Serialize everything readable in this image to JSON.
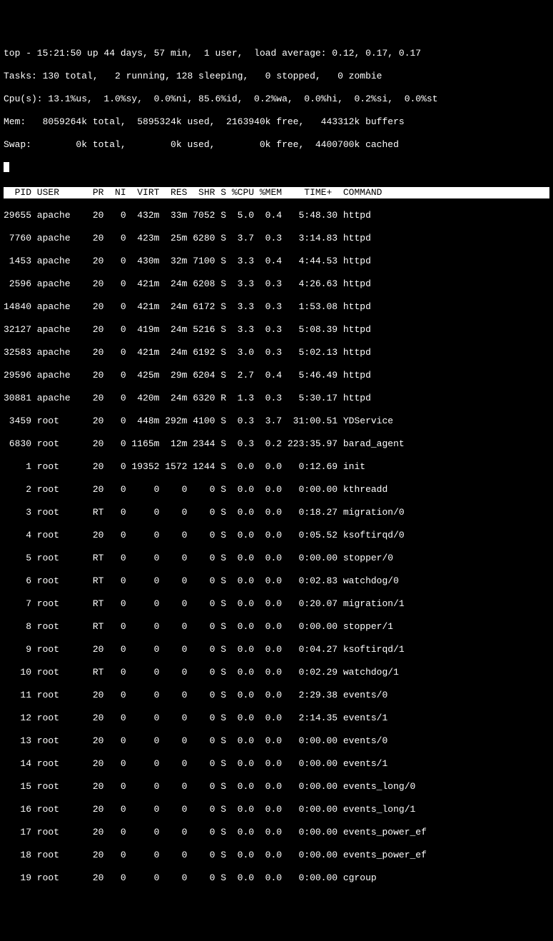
{
  "summary": {
    "line1": "top - 15:21:50 up 44 days, 57 min,  1 user,  load average: 0.12, 0.17, 0.17",
    "line2": "Tasks: 130 total,   2 running, 128 sleeping,   0 stopped,   0 zombie",
    "line3": "Cpu(s): 13.1%us,  1.0%sy,  0.0%ni, 85.6%id,  0.2%wa,  0.0%hi,  0.2%si,  0.0%st",
    "line4": "Mem:   8059264k total,  5895324k used,  2163940k free,   443312k buffers",
    "line5": "Swap:        0k total,        0k used,        0k free,  4400700k cached"
  },
  "header": "  PID USER      PR  NI  VIRT  RES  SHR S %CPU %MEM    TIME+  COMMAND           ",
  "rows": [
    "29655 apache    20   0  432m  33m 7052 S  5.0  0.4   5:48.30 httpd",
    " 7760 apache    20   0  423m  25m 6280 S  3.7  0.3   3:14.83 httpd",
    " 1453 apache    20   0  430m  32m 7100 S  3.3  0.4   4:44.53 httpd",
    " 2596 apache    20   0  421m  24m 6208 S  3.3  0.3   4:26.63 httpd",
    "14840 apache    20   0  421m  24m 6172 S  3.3  0.3   1:53.08 httpd",
    "32127 apache    20   0  419m  24m 5216 S  3.3  0.3   5:08.39 httpd",
    "32583 apache    20   0  421m  24m 6192 S  3.0  0.3   5:02.13 httpd",
    "29596 apache    20   0  425m  29m 6204 S  2.7  0.4   5:46.49 httpd",
    "30881 apache    20   0  420m  24m 6320 R  1.3  0.3   5:30.17 httpd",
    " 3459 root      20   0  448m 292m 4100 S  0.3  3.7  31:00.51 YDService",
    " 6830 root      20   0 1165m  12m 2344 S  0.3  0.2 223:35.97 barad_agent",
    "    1 root      20   0 19352 1572 1244 S  0.0  0.0   0:12.69 init",
    "    2 root      20   0     0    0    0 S  0.0  0.0   0:00.00 kthreadd",
    "    3 root      RT   0     0    0    0 S  0.0  0.0   0:18.27 migration/0",
    "    4 root      20   0     0    0    0 S  0.0  0.0   0:05.52 ksoftirqd/0",
    "    5 root      RT   0     0    0    0 S  0.0  0.0   0:00.00 stopper/0",
    "    6 root      RT   0     0    0    0 S  0.0  0.0   0:02.83 watchdog/0",
    "    7 root      RT   0     0    0    0 S  0.0  0.0   0:20.07 migration/1",
    "    8 root      RT   0     0    0    0 S  0.0  0.0   0:00.00 stopper/1",
    "    9 root      20   0     0    0    0 S  0.0  0.0   0:04.27 ksoftirqd/1",
    "   10 root      RT   0     0    0    0 S  0.0  0.0   0:02.29 watchdog/1",
    "   11 root      20   0     0    0    0 S  0.0  0.0   2:29.38 events/0",
    "   12 root      20   0     0    0    0 S  0.0  0.0   2:14.35 events/1",
    "   13 root      20   0     0    0    0 S  0.0  0.0   0:00.00 events/0",
    "   14 root      20   0     0    0    0 S  0.0  0.0   0:00.00 events/1",
    "   15 root      20   0     0    0    0 S  0.0  0.0   0:00.00 events_long/0",
    "   16 root      20   0     0    0    0 S  0.0  0.0   0:00.00 events_long/1",
    "   17 root      20   0     0    0    0 S  0.0  0.0   0:00.00 events_power_ef",
    "   18 root      20   0     0    0    0 S  0.0  0.0   0:00.00 events_power_ef",
    "   19 root      20   0     0    0    0 S  0.0  0.0   0:00.00 cgroup"
  ]
}
